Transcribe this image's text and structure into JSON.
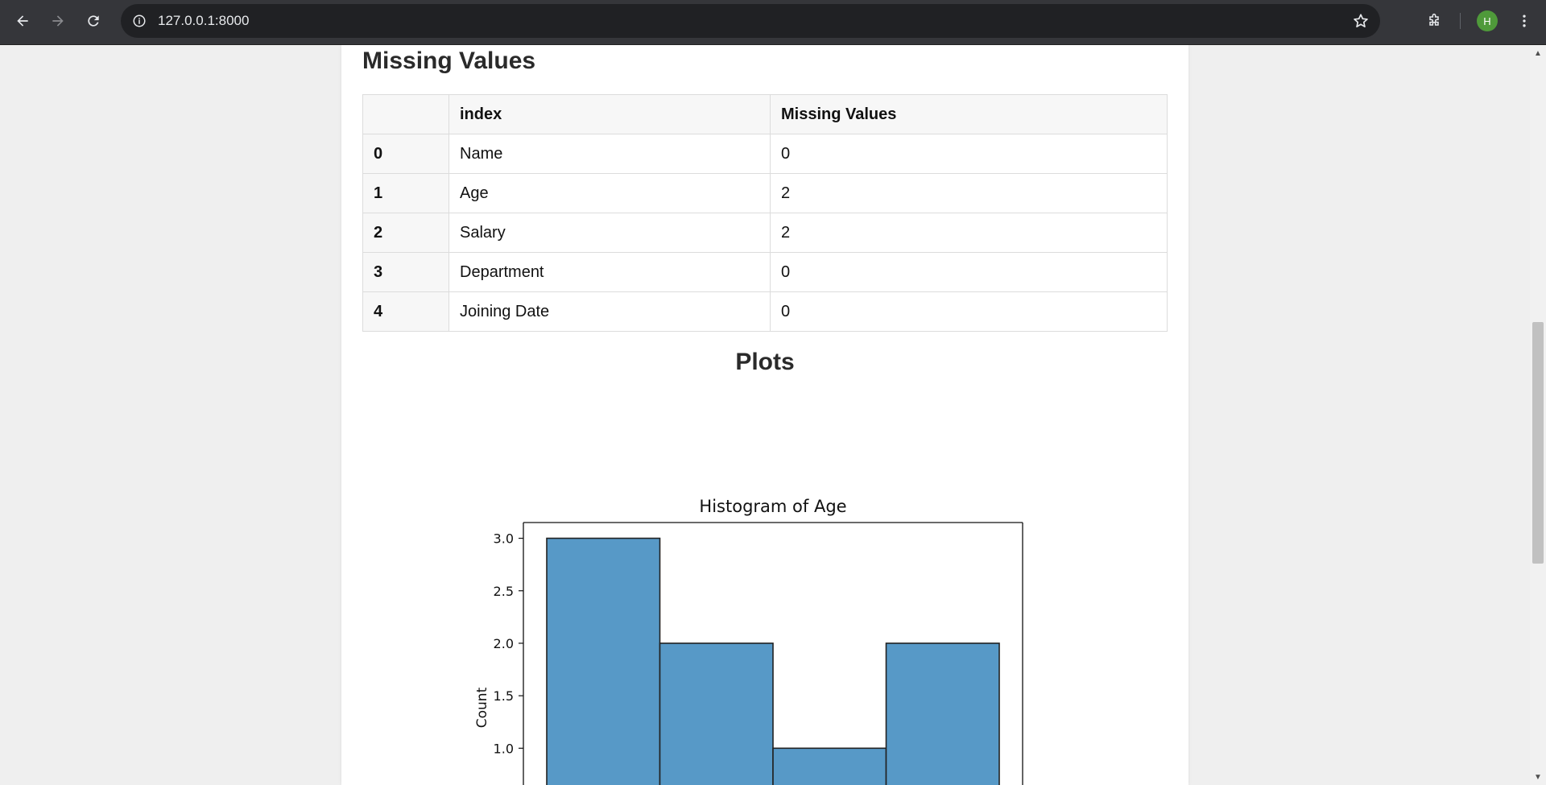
{
  "browser": {
    "url": "127.0.0.1:8000",
    "avatar_letter": "H"
  },
  "missing_values": {
    "title": "Missing Values",
    "columns": [
      "",
      "index",
      "Missing Values"
    ],
    "rows": [
      {
        "id": "0",
        "index": "Name",
        "missing": "0"
      },
      {
        "id": "1",
        "index": "Age",
        "missing": "2"
      },
      {
        "id": "2",
        "index": "Salary",
        "missing": "2"
      },
      {
        "id": "3",
        "index": "Department",
        "missing": "0"
      },
      {
        "id": "4",
        "index": "Joining Date",
        "missing": "0"
      }
    ]
  },
  "plots": {
    "title": "Plots"
  },
  "chart_data": {
    "type": "bar",
    "title": "Histogram of Age",
    "xlabel": "",
    "ylabel": "Count",
    "values": [
      3,
      2,
      1,
      2
    ],
    "yticks": [
      "3.0",
      "2.5",
      "2.0",
      "1.5",
      "1.0"
    ],
    "ylim_visible": [
      0.55,
      3.15
    ],
    "bar_color": "#5799c7",
    "edge_color": "#222222",
    "grid": false
  },
  "colors": {
    "chrome_bg": "#35363a",
    "omnibox_bg": "#202124",
    "avatar_bg": "#4f9a3a"
  }
}
